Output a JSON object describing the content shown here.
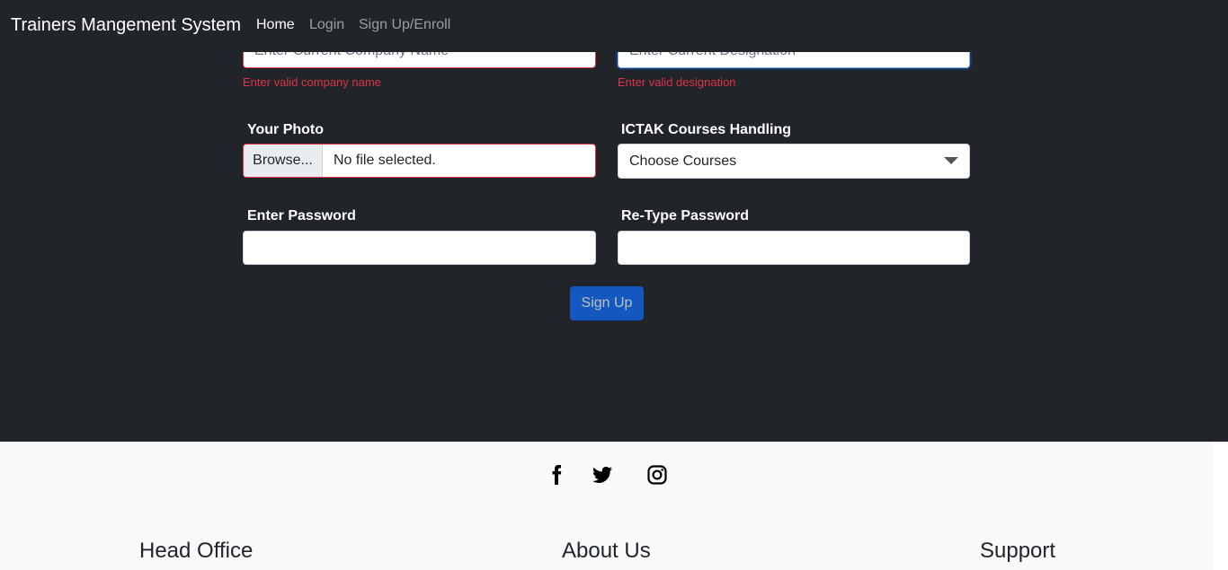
{
  "navbar": {
    "brand": "Trainers Mangement System",
    "links": [
      "Home",
      "Login",
      "Sign Up/Enroll"
    ]
  },
  "form": {
    "company": {
      "placeholder": "Enter Current Company Name",
      "error": "Enter valid company name"
    },
    "designation": {
      "placeholder": "Enter Current Designation",
      "error": "Enter valid designation"
    },
    "photo": {
      "label": "Your Photo",
      "browse": "Browse...",
      "status": "No file selected."
    },
    "courses": {
      "label": "ICTAK Courses Handling",
      "selected": "Choose Courses"
    },
    "password": {
      "label": "Enter Password",
      "value": ""
    },
    "retype_password": {
      "label": "Re-Type Password",
      "value": ""
    },
    "submit": "Sign Up"
  },
  "footer": {
    "social_icons": [
      "facebook-icon",
      "twitter-icon",
      "instagram-icon"
    ],
    "headings": [
      "Head Office",
      "About Us",
      "Support"
    ]
  },
  "colors": {
    "background": "#212529",
    "error": "#dc3545",
    "primary": "#0d6efd",
    "footer": "#f8f9fa"
  }
}
